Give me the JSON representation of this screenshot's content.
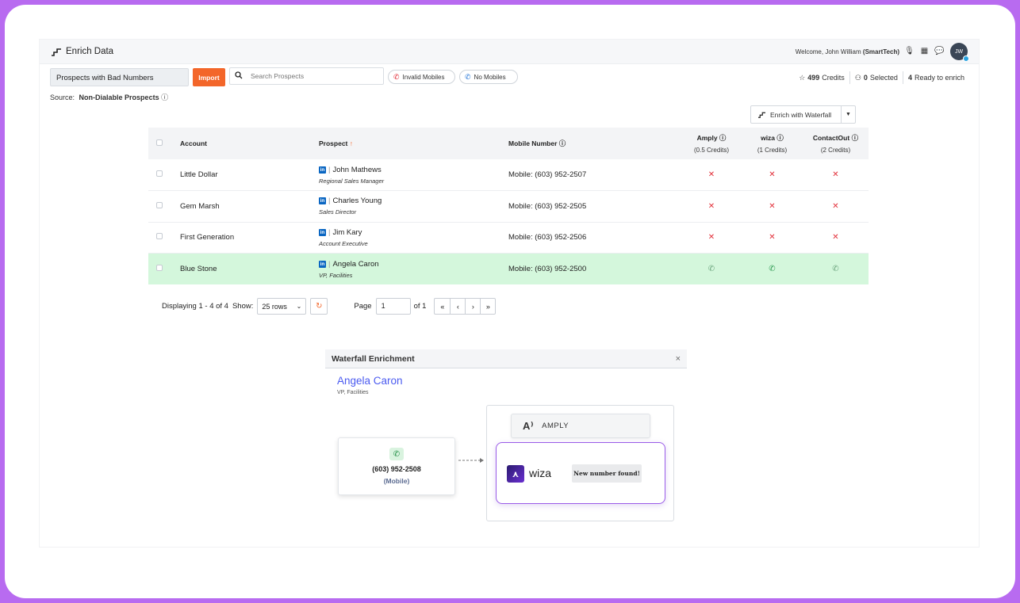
{
  "app": {
    "title": "Enrich Data",
    "welcome_prefix": "Welcome, John William",
    "welcome_org": "(SmartTech)",
    "avatar_initials": "JW"
  },
  "toolbar": {
    "list_name": "Prospects with Bad Numbers",
    "import_label": "Import",
    "search_placeholder": "Search Prospects",
    "chip_invalid": "Invalid Mobiles",
    "chip_nomobiles": "No Mobiles",
    "credits_value": "499",
    "credits_label": "Credits",
    "selected_value": "0",
    "selected_label": "Selected",
    "ready_value": "4",
    "ready_label": "Ready to enrich",
    "source_label": "Source:",
    "source_value": "Non-Dialable Prospects",
    "waterfall_label": "Enrich with Waterfall"
  },
  "table": {
    "headers": {
      "account": "Account",
      "prospect": "Prospect",
      "mobile": "Mobile Number",
      "amply": "Amply",
      "amply_sub": "(0.5 Credits)",
      "wiza": "wiza",
      "wiza_sub": "(1 Credits)",
      "contactout": "ContactOut",
      "contactout_sub": "(2 Credits)"
    },
    "rows": [
      {
        "account": "Little Dollar",
        "name": "John Mathews",
        "title": "Regional Sales Manager",
        "mobile": "Mobile: (603) 952-2507",
        "status": "fail"
      },
      {
        "account": "Gem Marsh",
        "name": "Charles Young",
        "title": "Sales Director",
        "mobile": "Mobile: (603) 952-2505",
        "status": "fail"
      },
      {
        "account": "First Generation",
        "name": "Jim Kary",
        "title": "Account Executive",
        "mobile": "Mobile: (603) 952-2506",
        "status": "fail"
      },
      {
        "account": "Blue Stone",
        "name": "Angela Caron",
        "title": "VP, Facilities",
        "mobile": "Mobile: (603) 952-2500",
        "status": "found"
      }
    ]
  },
  "pager": {
    "displaying": "Displaying 1 - 4 of 4",
    "show_label": "Show:",
    "rows_value": "25 rows",
    "page_label": "Page",
    "page_value": "1",
    "of_label": "of 1"
  },
  "modal": {
    "title": "Waterfall Enrichment",
    "close": "×",
    "name": "Angela Caron",
    "role": "VP, Facilities",
    "number": "(603) 952-2508",
    "number_type": "(Mobile)",
    "amply_label": "AMPLY",
    "wiza_label": "wiza",
    "found_label": "New number found!"
  }
}
